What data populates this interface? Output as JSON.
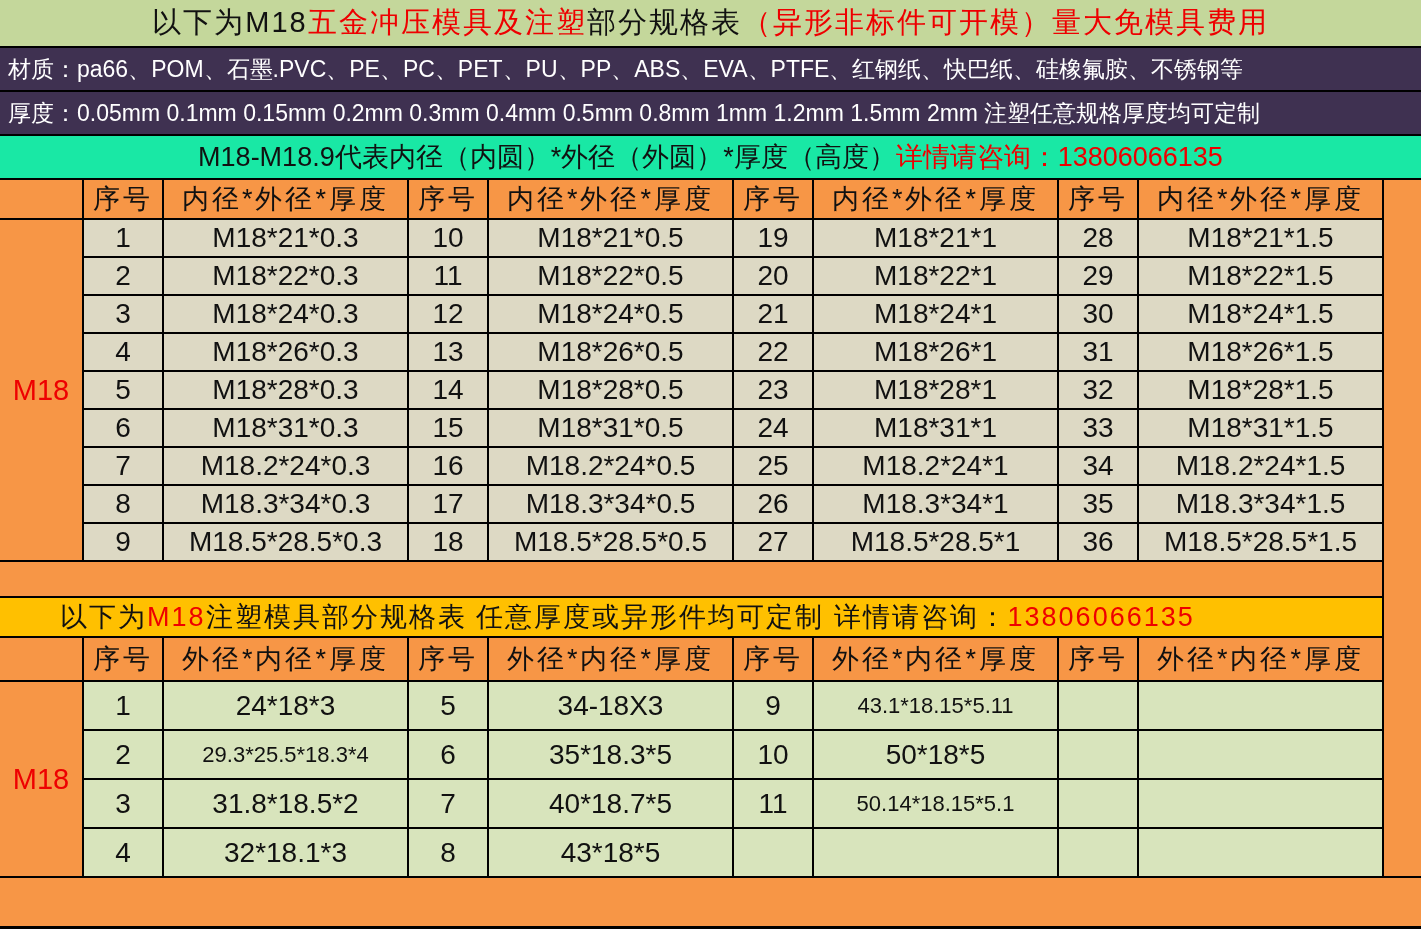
{
  "title": {
    "segments": [
      {
        "text": "以下为M18",
        "highlight": false
      },
      {
        "text": "五金冲压模具及注塑",
        "highlight": true
      },
      {
        "text": "部分规格表  ",
        "highlight": false
      },
      {
        "text": "（异形非标件可开模）",
        "highlight": true
      },
      {
        "text": "量大免模具费用",
        "highlight": true
      }
    ]
  },
  "materials": "材质：pa66、POM、石墨.PVC、PE、PC、PET、PU、PP、ABS、EVA、PTFE、红钢纸、快巴纸、硅橡氟胺、不锈钢等",
  "thickness": "厚度：0.05mm 0.1mm 0.15mm 0.2mm 0.3mm 0.4mm 0.5mm 0.8mm 1mm 1.2mm 1.5mm 2mm 注塑任意规格厚度均可定制",
  "note": {
    "segments": [
      {
        "text": "M18-M18.9代表内径（内圆）*外径（外圆）*厚度（高度）",
        "highlight": false
      },
      {
        "text": "详情请咨询：13806066135",
        "highlight": true
      }
    ]
  },
  "table_1": {
    "group_label": "M18",
    "headers": [
      "序号",
      "内径*外径*厚度",
      "序号",
      "内径*外径*厚度",
      "序号",
      "内径*外径*厚度",
      "序号",
      "内径*外径*厚度"
    ],
    "rows": [
      [
        "1",
        "M18*21*0.3",
        "10",
        "M18*21*0.5",
        "19",
        "M18*21*1",
        "28",
        "M18*21*1.5"
      ],
      [
        "2",
        "M18*22*0.3",
        "11",
        "M18*22*0.5",
        "20",
        "M18*22*1",
        "29",
        "M18*22*1.5"
      ],
      [
        "3",
        "M18*24*0.3",
        "12",
        "M18*24*0.5",
        "21",
        "M18*24*1",
        "30",
        "M18*24*1.5"
      ],
      [
        "4",
        "M18*26*0.3",
        "13",
        "M18*26*0.5",
        "22",
        "M18*26*1",
        "31",
        "M18*26*1.5"
      ],
      [
        "5",
        "M18*28*0.3",
        "14",
        "M18*28*0.5",
        "23",
        "M18*28*1",
        "32",
        "M18*28*1.5"
      ],
      [
        "6",
        "M18*31*0.3",
        "15",
        "M18*31*0.5",
        "24",
        "M18*31*1",
        "33",
        "M18*31*1.5"
      ],
      [
        "7",
        "M18.2*24*0.3",
        "16",
        "M18.2*24*0.5",
        "25",
        "M18.2*24*1",
        "34",
        "M18.2*24*1.5"
      ],
      [
        "8",
        "M18.3*34*0.3",
        "17",
        "M18.3*34*0.5",
        "26",
        "M18.3*34*1",
        "35",
        "M18.3*34*1.5"
      ],
      [
        "9",
        "M18.5*28.5*0.3",
        "18",
        "M18.5*28.5*0.5",
        "27",
        "M18.5*28.5*1",
        "36",
        "M18.5*28.5*1.5"
      ]
    ]
  },
  "table_2": {
    "title": {
      "segments": [
        {
          "text": "以下为",
          "highlight": false
        },
        {
          "text": "M18",
          "highlight": true
        },
        {
          "text": "注塑模具部分规格表  任意厚度或异形件均可定制    详情请咨询：",
          "highlight": false
        },
        {
          "text": "13806066135",
          "highlight": true
        }
      ]
    },
    "group_label": "M18",
    "headers": [
      "序号",
      "外径*内径*厚度",
      "序号",
      "外径*内径*厚度",
      "序号",
      "外径*内径*厚度",
      "序号",
      "外径*内径*厚度"
    ],
    "rows": [
      [
        "1",
        "24*18*3",
        "5",
        "34-18X3",
        "9",
        "43.1*18.15*5.11"
      ],
      [
        "2",
        "29.3*25.5*18.3*4",
        "6",
        "35*18.3*5",
        "10",
        "50*18*5"
      ],
      [
        "3",
        "31.8*18.5*2",
        "7",
        "40*18.7*5",
        "11",
        "50.14*18.15*5.1"
      ],
      [
        "4",
        "32*18.1*3",
        "8",
        "43*18*5"
      ]
    ]
  }
}
